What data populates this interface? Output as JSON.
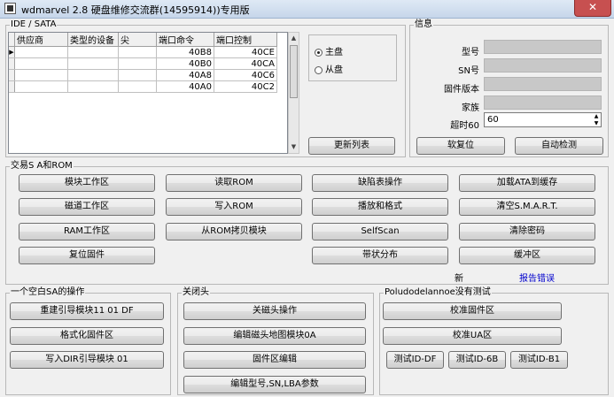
{
  "window": {
    "title": "wdmarvel 2.8 硬盘维修交流群(14595914))专用版",
    "close_label": "✕"
  },
  "ide_group": {
    "label": "IDE / SATA",
    "columns": [
      "供应商",
      "类型的设备",
      "尖",
      "端口命令",
      "端口控制"
    ],
    "rows": [
      {
        "vendor": "",
        "type": "",
        "tip": "",
        "cmd": "40B8",
        "ctrl": "40CE"
      },
      {
        "vendor": "",
        "type": "",
        "tip": "",
        "cmd": "40B0",
        "ctrl": "40CA"
      },
      {
        "vendor": "",
        "type": "",
        "tip": "",
        "cmd": "40A8",
        "ctrl": "40C6"
      },
      {
        "vendor": "",
        "type": "",
        "tip": "",
        "cmd": "40A0",
        "ctrl": "40C2"
      }
    ],
    "master_label": "主盘",
    "slave_label": "从盘",
    "refresh_label": "更新列表"
  },
  "info_group": {
    "label": "信息",
    "model_label": "型号",
    "sn_label": "SN号",
    "firmware_label": "固件版本",
    "family_label": "家族",
    "timeout_label": "超时60",
    "timeout_value": "60",
    "soft_reset_label": "软复位",
    "auto_detect_label": "自动检测"
  },
  "sa_group": {
    "label": "交易S A和ROM",
    "buttons": [
      "模块工作区",
      "读取ROM",
      "缺陷表操作",
      "加载ATA到缓存",
      "磁道工作区",
      "写入ROM",
      "播放和格式",
      "清空S.M.A.R.T.",
      "RAM工作区",
      "从ROM拷贝模块",
      "SelfScan",
      "清除密码",
      "复位固件",
      "带状分布",
      "缓冲区"
    ],
    "new_label": "新",
    "report_label": "报告错误"
  },
  "empty_sa_group": {
    "label": "一个空白SA的操作",
    "buttons": [
      "重建引导模块11 01 DF",
      "格式化固件区",
      "写入DIR引导模块 01"
    ]
  },
  "heads_group": {
    "label": "关闭头",
    "buttons": [
      "关磁头操作",
      "编辑磁头地图模块0A",
      "固件区编辑",
      "编辑型号,SN,LBA参数"
    ]
  },
  "test_group": {
    "label": "Poludodelannoe没有测试",
    "buttons": [
      "校准固件区",
      "校准UA区"
    ],
    "test_buttons": [
      "测试ID-DF",
      "测试ID-6B",
      "测试ID-B1"
    ]
  }
}
